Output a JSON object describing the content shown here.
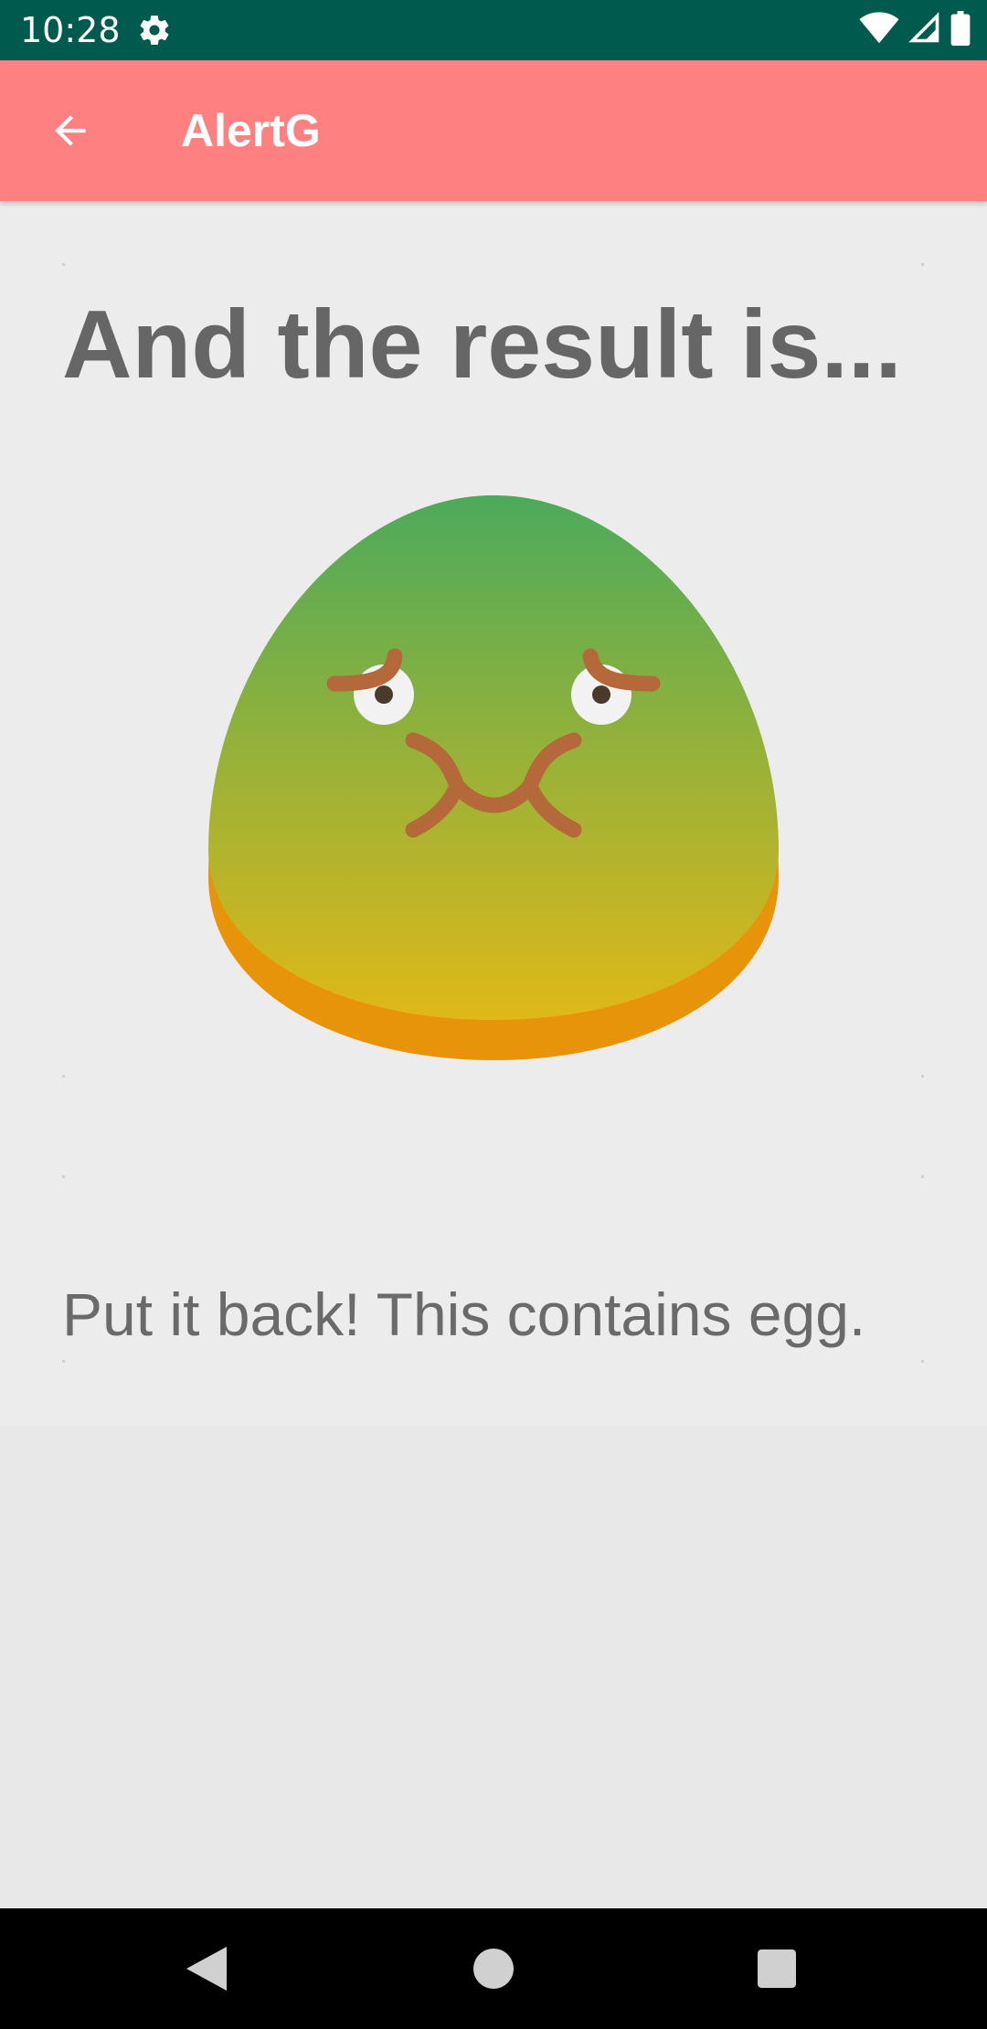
{
  "status_bar": {
    "time": "10:28",
    "icons": [
      "settings-gear-icon",
      "wifi-icon",
      "cellular-signal-icon",
      "battery-icon"
    ]
  },
  "app_bar": {
    "title": "AlertG",
    "back_icon": "arrow-back-icon",
    "background": "#ff8080"
  },
  "result": {
    "headline": "And the result is...",
    "illustration": "sick-face-blob-icon",
    "message": "Put it back! This contains egg."
  },
  "nav_bar": {
    "icons": [
      "back-triangle-icon",
      "home-circle-icon",
      "recents-square-icon"
    ]
  },
  "colors": {
    "status_bar": "#005a4e",
    "text_gray": "#666666",
    "blob_top": "#4caa5c",
    "blob_bottom": "#e0b818",
    "blob_edge": "#e8940a",
    "face_feature": "#b5693a"
  }
}
